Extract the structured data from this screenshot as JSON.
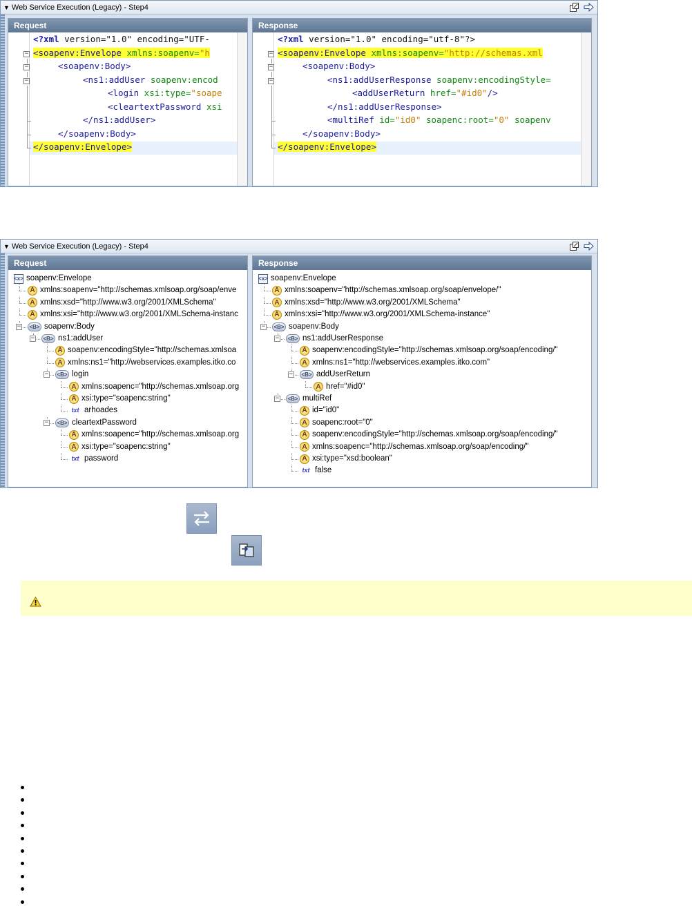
{
  "panel1": {
    "title": "Web Service Execution (Legacy) - Step4",
    "request": {
      "header": "Request",
      "lines": [
        {
          "t1": "<?xml",
          "t2": " version=\"1.0\" encoding=\"UTF-"
        },
        {
          "t1": "<soapenv:Envelope",
          "t2": " xmlns:soapenv=",
          "t3": "\"h"
        },
        {
          "t1": "<soapenv:Body>"
        },
        {
          "t1": "<ns1:addUser",
          "t2": " soapenv:encod"
        },
        {
          "t1": "<login",
          "t2": " xsi:type=",
          "t3": "\"soape"
        },
        {
          "t1": "<cleartextPassword",
          "t2": " xsi"
        },
        {
          "t1": "</ns1:addUser>"
        },
        {
          "t1": "</soapenv:Body>"
        },
        {
          "t1": "</soapenv:Envelope>"
        }
      ]
    },
    "response": {
      "header": "Response",
      "lines": [
        {
          "t1": "<?xml",
          "t2": " version=\"1.0\" encoding=\"utf-8\"?>"
        },
        {
          "t1": "<soapenv:Envelope",
          "t2": " xmlns:soapenv=",
          "t3": "\"http://schemas.xml"
        },
        {
          "t1": "<soapenv:Body>"
        },
        {
          "t1": "<ns1:addUserResponse",
          "t2": " soapenv:encodingStyle="
        },
        {
          "t1": "<addUserReturn",
          "t2": " href=",
          "t3": "\"#id0\"",
          "t4": "/>"
        },
        {
          "t1": "</ns1:addUserResponse>"
        },
        {
          "t1": "<multiRef",
          "t2": " id=",
          "t3": "\"id0\"",
          "t4": " soapenc:root=",
          "t5": "\"0\"",
          "t6": " soapenv"
        },
        {
          "t1": "</soapenv:Body>"
        },
        {
          "t1": "</soapenv:Envelope>"
        }
      ]
    }
  },
  "panel2": {
    "title": "Web Service Execution (Legacy) - Step4",
    "request": {
      "header": "Request",
      "nodes": [
        {
          "type": "x",
          "label": "soapenv:Envelope"
        },
        {
          "type": "a",
          "label": "xmlns:soapenv=\"http://schemas.xmlsoap.org/soap/enve"
        },
        {
          "type": "a",
          "label": "xmlns:xsd=\"http://www.w3.org/2001/XMLSchema\""
        },
        {
          "type": "a",
          "label": "xmlns:xsi=\"http://www.w3.org/2001/XMLSchema-instanc"
        },
        {
          "type": "b",
          "label": "soapenv:Body"
        },
        {
          "type": "b",
          "label": "ns1:addUser"
        },
        {
          "type": "a",
          "label": "soapenv:encodingStyle=\"http://schemas.xmlsoa"
        },
        {
          "type": "a",
          "label": "xmlns:ns1=\"http://webservices.examples.itko.co"
        },
        {
          "type": "b",
          "label": "login"
        },
        {
          "type": "a",
          "label": "xmlns:soapenc=\"http://schemas.xmlsoap.org"
        },
        {
          "type": "a",
          "label": "xsi:type=\"soapenc:string\""
        },
        {
          "type": "t",
          "label": "arhoades"
        },
        {
          "type": "b",
          "label": "cleartextPassword"
        },
        {
          "type": "a",
          "label": "xmlns:soapenc=\"http://schemas.xmlsoap.org"
        },
        {
          "type": "a",
          "label": "xsi:type=\"soapenc:string\""
        },
        {
          "type": "t",
          "label": "password"
        }
      ]
    },
    "response": {
      "header": "Response",
      "nodes": [
        {
          "type": "x",
          "label": "soapenv:Envelope"
        },
        {
          "type": "a",
          "label": "xmlns:soapenv=\"http://schemas.xmlsoap.org/soap/envelope/\""
        },
        {
          "type": "a",
          "label": "xmlns:xsd=\"http://www.w3.org/2001/XMLSchema\""
        },
        {
          "type": "a",
          "label": "xmlns:xsi=\"http://www.w3.org/2001/XMLSchema-instance\""
        },
        {
          "type": "b",
          "label": "soapenv:Body"
        },
        {
          "type": "b",
          "label": "ns1:addUserResponse"
        },
        {
          "type": "a",
          "label": "soapenv:encodingStyle=\"http://schemas.xmlsoap.org/soap/encoding/\""
        },
        {
          "type": "a",
          "label": "xmlns:ns1=\"http://webservices.examples.itko.com\""
        },
        {
          "type": "b",
          "label": "addUserReturn"
        },
        {
          "type": "a",
          "label": "href=\"#id0\""
        },
        {
          "type": "b",
          "label": "multiRef"
        },
        {
          "type": "a",
          "label": "id=\"id0\""
        },
        {
          "type": "a",
          "label": "soapenc:root=\"0\""
        },
        {
          "type": "a",
          "label": "soapenv:encodingStyle=\"http://schemas.xmlsoap.org/soap/encoding/\""
        },
        {
          "type": "a",
          "label": "xmlns:soapenc=\"http://schemas.xmlsoap.org/soap/encoding/\""
        },
        {
          "type": "a",
          "label": "xsi:type=\"xsd:boolean\""
        },
        {
          "type": "t",
          "label": "false"
        }
      ]
    }
  },
  "icons": {
    "swap": "swap-arrows-icon",
    "compare": "compare-window-icon",
    "warning": "warning-triangle-icon",
    "detach": "detach-window-icon",
    "navigate": "arrow-right-icon"
  },
  "bullet_count": 10
}
